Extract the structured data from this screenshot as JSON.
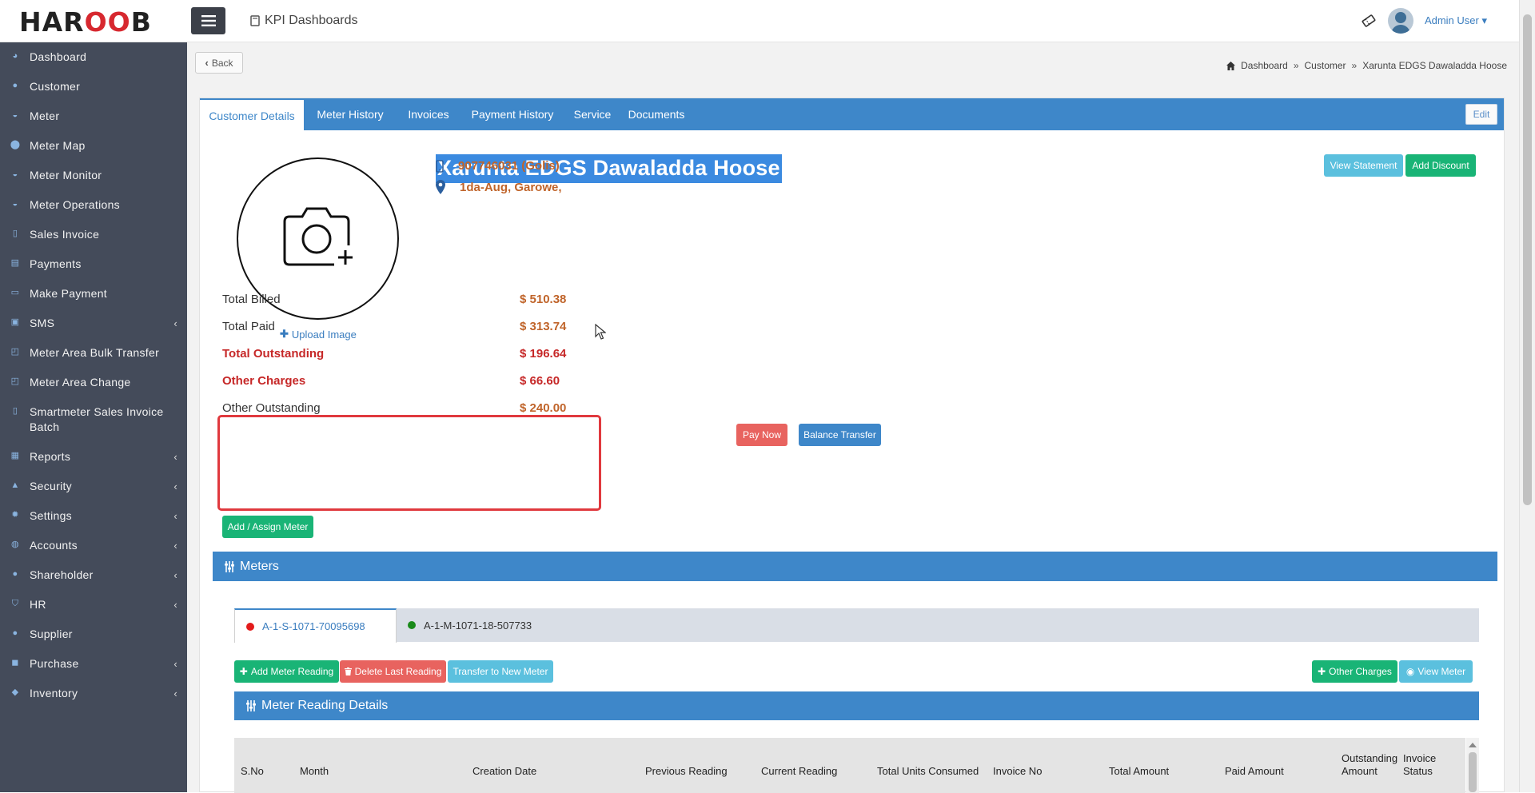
{
  "brand": {
    "logo_pre": "HAR",
    "logo_oo": "OO",
    "logo_post": "B"
  },
  "header": {
    "app_title": "KPI Dashboards",
    "user_name": "Admin User"
  },
  "sidebar": {
    "items": [
      {
        "label": "Dashboard",
        "icon": "dashboard-icon",
        "submenu": false
      },
      {
        "label": "Customer",
        "icon": "user-icon",
        "submenu": false
      },
      {
        "label": "Meter",
        "icon": "gauge-icon",
        "submenu": false
      },
      {
        "label": "Meter Map",
        "icon": "map-pin-icon",
        "submenu": false
      },
      {
        "label": "Meter Monitor",
        "icon": "gauge-icon",
        "submenu": false
      },
      {
        "label": "Meter Operations",
        "icon": "gauge-icon",
        "submenu": false
      },
      {
        "label": "Sales Invoice",
        "icon": "file-icon",
        "submenu": false
      },
      {
        "label": "Payments",
        "icon": "list-icon",
        "submenu": false
      },
      {
        "label": "Make Payment",
        "icon": "credit-card-icon",
        "submenu": false
      },
      {
        "label": "SMS",
        "icon": "sms-icon",
        "submenu": true
      },
      {
        "label": "Meter Area Bulk Transfer",
        "icon": "transfer-icon",
        "submenu": false
      },
      {
        "label": "Meter Area Change",
        "icon": "transfer-icon",
        "submenu": false
      },
      {
        "label": "Smartmeter Sales Invoice Batch",
        "icon": "file-icon",
        "submenu": false
      },
      {
        "label": "Reports",
        "icon": "report-icon",
        "submenu": true
      },
      {
        "label": "Security",
        "icon": "lock-icon",
        "submenu": true
      },
      {
        "label": "Settings",
        "icon": "gear-icon",
        "submenu": true
      },
      {
        "label": "Accounts",
        "icon": "money-icon",
        "submenu": true
      },
      {
        "label": "Shareholder",
        "icon": "user-icon",
        "submenu": true
      },
      {
        "label": "HR",
        "icon": "badge-icon",
        "submenu": true
      },
      {
        "label": "Supplier",
        "icon": "user-icon",
        "submenu": false
      },
      {
        "label": "Purchase",
        "icon": "cart-icon",
        "submenu": true
      },
      {
        "label": "Inventory",
        "icon": "box-icon",
        "submenu": true
      }
    ]
  },
  "toolbar": {
    "back_label": "Back"
  },
  "breadcrumb": {
    "home": "Dashboard",
    "level1": "Customer",
    "current": "Xarunta EDGS Dawaladda Hoose",
    "separator": "»"
  },
  "tabs": [
    "Customer Details",
    "Meter History",
    "Invoices",
    "Payment History",
    "Service",
    "Documents"
  ],
  "actions": {
    "edit": "Edit",
    "view_statement": "View Statement",
    "add_discount": "Add Discount",
    "pay_now": "Pay Now",
    "balance_transfer": "Balance Transfer",
    "add_assign_meter": "Add / Assign Meter",
    "upload_image": "Upload Image"
  },
  "customer": {
    "name": "Xarunta EDGS Dawaladda Hoose",
    "phone": "907746031 (Golis)",
    "address": "1da-Aug, Garowe,"
  },
  "summary": [
    {
      "label": "Total Billed",
      "value": "$ 510.38",
      "highlight": false
    },
    {
      "label": "Total Paid",
      "value": "$ 313.74",
      "highlight": false
    },
    {
      "label": "Total Outstanding",
      "value": "$ 196.64",
      "highlight": true
    },
    {
      "label": "Other Charges",
      "value": "$ 66.60",
      "highlight": true
    },
    {
      "label": "Other Outstanding",
      "value": "$ 240.00",
      "highlight": false
    }
  ],
  "meters": {
    "section_title": "Meters",
    "tabs": [
      {
        "label": "A-1-S-1071-70095698",
        "status_color": "#e31b1b"
      },
      {
        "label": "A-1-M-1071-18-507733",
        "status_color": "#1a8a1a"
      }
    ],
    "buttons": {
      "add_reading": "Add Meter Reading",
      "delete_last": "Delete Last Reading",
      "transfer": "Transfer to New Meter",
      "other_charges": "Other Charges",
      "view_meter": "View Meter"
    },
    "reading_title": "Meter Reading Details",
    "columns": [
      "S.No",
      "Month",
      "Creation Date",
      "Previous Reading",
      "Current Reading",
      "Total Units Consumed",
      "Invoice No",
      "Total Amount",
      "Paid Amount",
      "Outstanding Amount",
      "Invoice Status"
    ]
  },
  "colors": {
    "sidebar_bg": "#444b5a",
    "accent_blue": "#3e87c9",
    "alert_red": "#e0393e",
    "amount_orange": "#c0642a",
    "success_green": "#19b476",
    "info_teal": "#5bc0de"
  }
}
